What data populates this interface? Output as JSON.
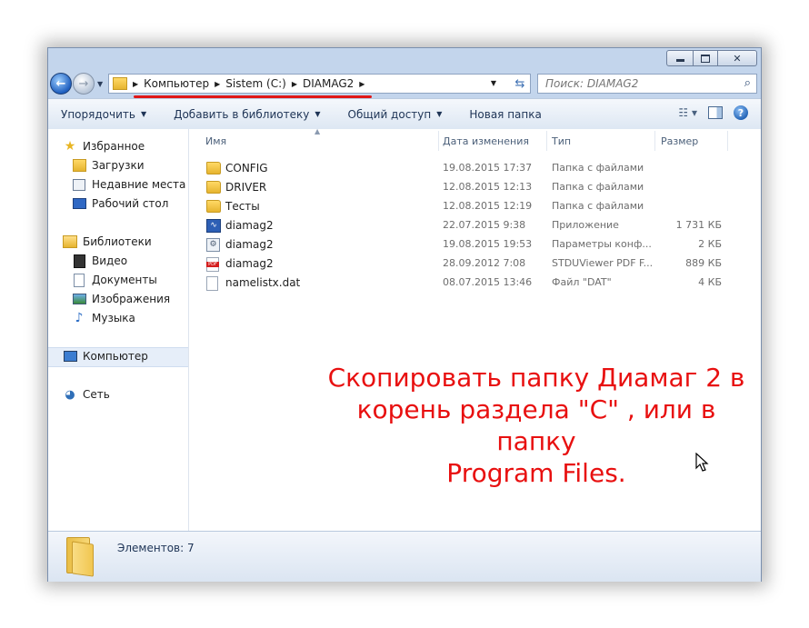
{
  "address": {
    "segments": [
      "Компьютер",
      "Sistem (C:)",
      "DIAMAG2"
    ],
    "search_placeholder": "Поиск: DIAMAG2"
  },
  "toolbar": {
    "organize": "Упорядочить",
    "add_to_library": "Добавить в библиотеку",
    "share": "Общий доступ",
    "new_folder": "Новая папка"
  },
  "nav": {
    "favorites": "Избранное",
    "downloads": "Загрузки",
    "recent": "Недавние места",
    "desktop": "Рабочий стол",
    "libraries": "Библиотеки",
    "video": "Видео",
    "documents": "Документы",
    "images": "Изображения",
    "music": "Музыка",
    "computer": "Компьютер",
    "network": "Сеть"
  },
  "columns": {
    "name": "Имя",
    "date": "Дата изменения",
    "type": "Тип",
    "size": "Размер"
  },
  "files": [
    {
      "icon": "folder-icon",
      "name": "CONFIG",
      "date": "19.08.2015 17:37",
      "type": "Папка с файлами",
      "size": ""
    },
    {
      "icon": "folder-icon",
      "name": "DRIVER",
      "date": "12.08.2015 12:13",
      "type": "Папка с файлами",
      "size": ""
    },
    {
      "icon": "folder-icon",
      "name": "Тесты",
      "date": "12.08.2015 12:19",
      "type": "Папка с файлами",
      "size": ""
    },
    {
      "icon": "application-icon",
      "name": "diamag2",
      "date": "22.07.2015 9:38",
      "type": "Приложение",
      "size": "1 731 КБ"
    },
    {
      "icon": "settings-file-icon",
      "name": "diamag2",
      "date": "19.08.2015 19:53",
      "type": "Параметры конф...",
      "size": "2 КБ"
    },
    {
      "icon": "pdf-file-icon",
      "name": "diamag2",
      "date": "28.09.2012 7:08",
      "type": "STDUViewer PDF F...",
      "size": "889 КБ"
    },
    {
      "icon": "dat-file-icon",
      "name": "namelistx.dat",
      "date": "08.07.2015 13:46",
      "type": "Файл \"DAT\"",
      "size": "4 КБ"
    }
  ],
  "annotation": {
    "line1": "Скопировать папку Диамаг 2 в",
    "line2": "корень раздела \"C\" , или в папку",
    "line3": "Program Files."
  },
  "status": {
    "items": "Элементов: 7"
  },
  "colors": {
    "annotation_red": "#e81010",
    "underline_red": "#e01818",
    "window_frame": "#c3d5ec"
  }
}
